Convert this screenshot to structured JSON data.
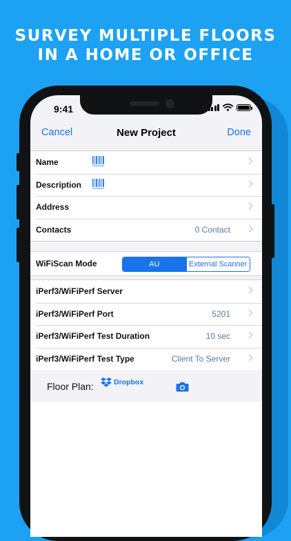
{
  "headline": {
    "line1": "SURVEY MULTIPLE FLOORS",
    "line2": "IN A HOME OR OFFICE"
  },
  "status_bar": {
    "time": "9:41"
  },
  "nav": {
    "cancel_label": "Cancel",
    "title": "New Project",
    "done_label": "Done"
  },
  "project_fields": [
    {
      "label": "Name",
      "value": ""
    },
    {
      "label": "Description",
      "value": ""
    },
    {
      "label": "Address",
      "value": ""
    },
    {
      "label": "Contacts",
      "value": "0 Contact"
    }
  ],
  "wifiscan": {
    "label": "WiFiScan Mode",
    "options": [
      "AU",
      "External Scanner"
    ],
    "selected": "AU"
  },
  "iperf_fields": [
    {
      "label": "iPerf3/WiFiPerf Server",
      "value": ""
    },
    {
      "label": "iPerf3/WiFiPerf Port",
      "value": "5201"
    },
    {
      "label": "iPerf3/WiFiPerf Test Duration",
      "value": "10 sec"
    },
    {
      "label": "iPerf3/WiFiPerf Test Type",
      "value": "Client To Server"
    }
  ],
  "floor_plan": {
    "label": "Floor Plan:",
    "dropbox_label": "Dropbox"
  },
  "colors": {
    "background": "#1da1f2",
    "accent": "#1a73e8",
    "value_text": "#5677a8"
  },
  "icons": [
    "barcode-icon",
    "chevron-right-icon",
    "dropbox-icon",
    "camera-icon",
    "wifi-icon",
    "signal-icon",
    "battery-icon"
  ]
}
